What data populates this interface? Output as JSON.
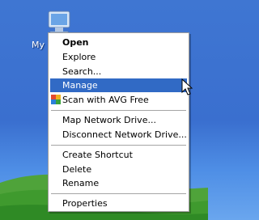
{
  "desktop": {
    "icon_label": "My",
    "icon": "computer-icon"
  },
  "context_menu": {
    "items": [
      {
        "label": "Open",
        "bold": true
      },
      {
        "label": "Explore"
      },
      {
        "label": "Search..."
      },
      {
        "label": "Manage",
        "selected": true
      },
      {
        "label": "Scan with AVG Free",
        "icon": "avg-icon"
      },
      {
        "label": "Map Network Drive..."
      },
      {
        "label": "Disconnect Network Drive..."
      },
      {
        "label": "Create Shortcut"
      },
      {
        "label": "Delete"
      },
      {
        "label": "Rename"
      },
      {
        "label": "Properties"
      }
    ]
  },
  "colors": {
    "selection": "#316ac5",
    "desktop_blue": "#3a6fcf",
    "grass_green": "#3f9a2e"
  },
  "cursor": "arrow-cursor-icon"
}
